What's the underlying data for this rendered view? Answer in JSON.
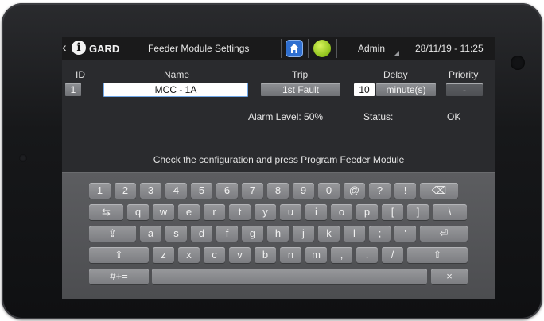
{
  "header": {
    "back_glyph": "‹",
    "logo_letter": "i",
    "logo_text": "GARD",
    "title": "Feeder Module Settings",
    "home_icon": "home-icon",
    "status_color": "#a5d62b",
    "user": "Admin",
    "datetime": "28/11/19 - 11:25"
  },
  "columns": {
    "id": "ID",
    "name": "Name",
    "trip": "Trip",
    "delay": "Delay",
    "priority": "Priority"
  },
  "fields": {
    "id": "1",
    "name": "MCC - 1A",
    "trip": "1st Fault",
    "delay_value": "10",
    "delay_unit": "minute(s)",
    "priority": "-"
  },
  "info": {
    "alarm_level": "Alarm Level: 50%",
    "status_label": "Status:",
    "status_value": "OK"
  },
  "message": "Check the configuration and press Program Feeder Module",
  "keyboard": {
    "rows": [
      [
        "1",
        "2",
        "3",
        "4",
        "5",
        "6",
        "7",
        "8",
        "9",
        "0",
        "@",
        "?",
        "!",
        "⌫"
      ],
      [
        "⇆",
        "q",
        "w",
        "e",
        "r",
        "t",
        "y",
        "u",
        "i",
        "o",
        "p",
        "[",
        "]",
        "\\"
      ],
      [
        "⇪",
        "a",
        "s",
        "d",
        "f",
        "g",
        "h",
        "j",
        "k",
        "l",
        ";",
        "'",
        "⏎"
      ],
      [
        "⇧",
        "z",
        "x",
        "c",
        "v",
        "b",
        "n",
        "m",
        ",",
        ".",
        "/",
        "⇧"
      ],
      [
        "#+=",
        "",
        "×"
      ]
    ]
  }
}
